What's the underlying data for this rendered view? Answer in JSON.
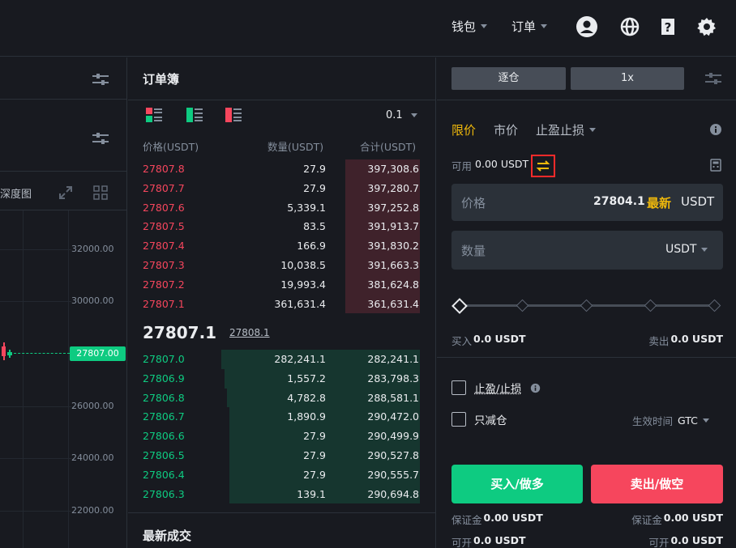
{
  "topbar": {
    "wallet_label": "钱包",
    "orders_label": "订单"
  },
  "chart": {
    "depth_label": "深度图",
    "y_ticks": [
      "32000.00",
      "30000.00",
      "26000.00",
      "24000.00",
      "22000.00"
    ],
    "current_price": "27807.00",
    "colors": {
      "up": "#0ecb81",
      "down": "#f6465d"
    }
  },
  "orderbook": {
    "title": "订单簿",
    "precision": "0.1",
    "col_price": "价格(USDT)",
    "col_qty": "数量(USDT)",
    "col_total": "合计(USDT)",
    "asks": [
      {
        "price": "27807.8",
        "qty": "27.9",
        "total": "397,308.6",
        "depth": 0.27
      },
      {
        "price": "27807.7",
        "qty": "27.9",
        "total": "397,280.7",
        "depth": 0.27
      },
      {
        "price": "27807.6",
        "qty": "5,339.1",
        "total": "397,252.8",
        "depth": 0.27
      },
      {
        "price": "27807.5",
        "qty": "83.5",
        "total": "391,913.7",
        "depth": 0.27
      },
      {
        "price": "27807.4",
        "qty": "166.9",
        "total": "391,830.2",
        "depth": 0.27
      },
      {
        "price": "27807.3",
        "qty": "10,038.5",
        "total": "391,663.3",
        "depth": 0.27
      },
      {
        "price": "27807.2",
        "qty": "19,993.4",
        "total": "381,624.8",
        "depth": 0.27
      },
      {
        "price": "27807.1",
        "qty": "361,631.4",
        "total": "361,631.4",
        "depth": 0.27
      }
    ],
    "last_price": "27807.1",
    "mark_price": "27808.1",
    "bids": [
      {
        "price": "27807.0",
        "qty": "282,241.1",
        "total": "282,241.1",
        "depth": 0.72
      },
      {
        "price": "27806.9",
        "qty": "1,557.2",
        "total": "283,798.3",
        "depth": 0.71
      },
      {
        "price": "27806.8",
        "qty": "4,782.8",
        "total": "288,581.1",
        "depth": 0.7
      },
      {
        "price": "27806.7",
        "qty": "1,890.9",
        "total": "290,472.0",
        "depth": 0.69
      },
      {
        "price": "27806.6",
        "qty": "27.9",
        "total": "290,499.9",
        "depth": 0.69
      },
      {
        "price": "27806.5",
        "qty": "27.9",
        "total": "290,527.8",
        "depth": 0.69
      },
      {
        "price": "27806.4",
        "qty": "27.9",
        "total": "290,555.7",
        "depth": 0.69
      },
      {
        "price": "27806.3",
        "qty": "139.1",
        "total": "290,694.8",
        "depth": 0.69
      }
    ],
    "trades_title": "最新成交"
  },
  "order_form": {
    "margin_mode": "逐仓",
    "leverage": "1x",
    "tabs": {
      "limit": "限价",
      "market": "市价",
      "stop": "止盈止损"
    },
    "available_label": "可用",
    "available_value": "0.00 USDT",
    "price_label": "价格",
    "price_value": "27804.1",
    "latest_label": "最新",
    "price_unit": "USDT",
    "qty_label": "数量",
    "qty_unit": "USDT",
    "buy_label": "买入",
    "buy_value": "0.0 USDT",
    "sell_label": "卖出",
    "sell_value": "0.0 USDT",
    "tpsl_label": "止盈/止损",
    "reduce_only_label": "只减仓",
    "tif_label": "生效时间",
    "tif_value": "GTC",
    "buy_button": "买入/做多",
    "sell_button": "卖出/做空",
    "margin_label": "保证金",
    "margin_buy": "0.00 USDT",
    "margin_sell": "0.00 USDT",
    "open_label": "可开",
    "open_buy": "0.0 USDT",
    "open_sell": "0.0 USDT",
    "accent": "#f0b90b"
  }
}
